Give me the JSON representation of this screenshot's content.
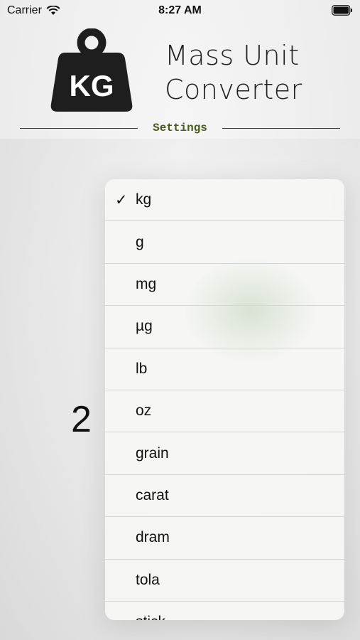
{
  "status_bar": {
    "carrier": "Carrier",
    "time": "8:27 AM"
  },
  "header": {
    "logo_text": "KG",
    "title_line1": "Mass Unit",
    "title_line2": "Converter",
    "section_label": "Settings"
  },
  "value_display": "2",
  "unit_menu": {
    "selected": "kg",
    "check_glyph": "✓",
    "items": [
      {
        "label": "kg",
        "checked": true
      },
      {
        "label": "g",
        "checked": false
      },
      {
        "label": "mg",
        "checked": false
      },
      {
        "label": "µg",
        "checked": false
      },
      {
        "label": "lb",
        "checked": false
      },
      {
        "label": "oz",
        "checked": false
      },
      {
        "label": "grain",
        "checked": false
      },
      {
        "label": "carat",
        "checked": false
      },
      {
        "label": "dram",
        "checked": false
      },
      {
        "label": "tola",
        "checked": false
      },
      {
        "label": "stick",
        "checked": false
      }
    ]
  },
  "colors": {
    "settings_label": "#4a5a1c",
    "logo": "#1e1e1e",
    "text": "#111111"
  }
}
